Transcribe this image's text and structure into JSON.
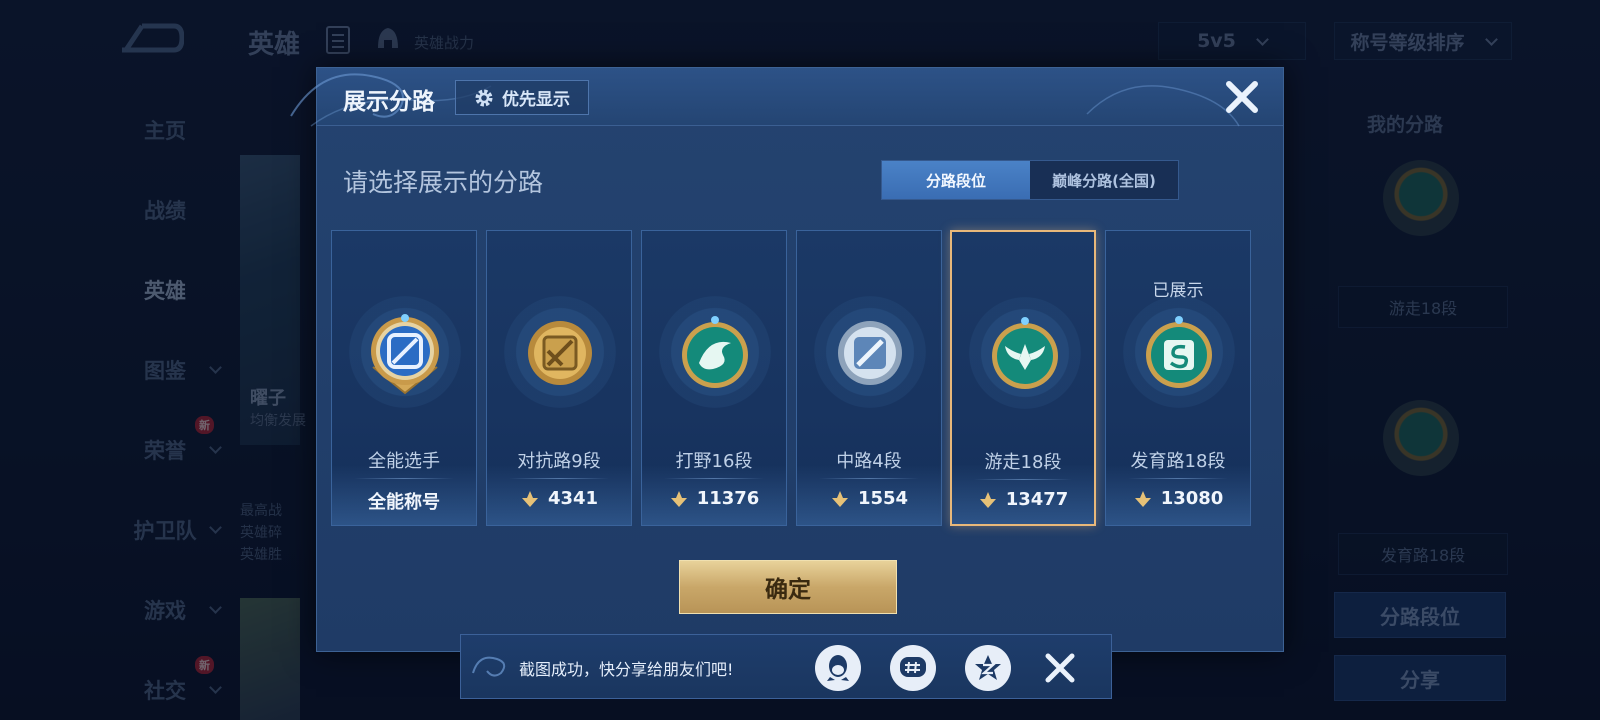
{
  "background": {
    "top_title": "英雄",
    "top_power_label": "英雄战力",
    "mode_select": "5v5",
    "sort_select": "称号等级排序",
    "nav": [
      {
        "label": "主页",
        "active": false,
        "expandable": false,
        "badge": ""
      },
      {
        "label": "战绩",
        "active": false,
        "expandable": false,
        "badge": ""
      },
      {
        "label": "英雄",
        "active": true,
        "expandable": false,
        "badge": ""
      },
      {
        "label": "图鉴",
        "active": false,
        "expandable": true,
        "badge": ""
      },
      {
        "label": "荣誉",
        "active": false,
        "expandable": true,
        "badge": "新"
      },
      {
        "label": "护卫队",
        "active": false,
        "expandable": true,
        "badge": ""
      },
      {
        "label": "游戏",
        "active": false,
        "expandable": true,
        "badge": ""
      },
      {
        "label": "社交",
        "active": false,
        "expandable": true,
        "badge": "新"
      }
    ],
    "hero_name": "曜子",
    "hero_sub": "均衡发展",
    "hero_stats": [
      "最高战",
      "英雄碎",
      "英雄胜"
    ],
    "right_panel": {
      "title": "我的分路",
      "slot1_label": "游走18段",
      "slot2_label": "发育路18段",
      "btn_lane_rank": "分路段位",
      "btn_share": "分享"
    }
  },
  "modal": {
    "title": "展示分路",
    "priority_button": "优先显示",
    "subtitle": "请选择展示的分路",
    "tabs": [
      {
        "label": "分路段位",
        "active": true
      },
      {
        "label": "巅峰分路(全国)",
        "active": false
      }
    ],
    "cards": [
      {
        "rank": "全能选手",
        "score": "全能称号",
        "has_score_icon": false,
        "medal": "all-round-medal",
        "shown_label": "",
        "selected": false
      },
      {
        "rank": "对抗路9段",
        "score": "4341",
        "has_score_icon": true,
        "medal": "clash-lane-medal",
        "shown_label": "",
        "selected": false
      },
      {
        "rank": "打野16段",
        "score": "11376",
        "has_score_icon": true,
        "medal": "jungle-medal",
        "shown_label": "",
        "selected": false
      },
      {
        "rank": "中路4段",
        "score": "1554",
        "has_score_icon": true,
        "medal": "mid-lane-medal",
        "shown_label": "",
        "selected": false
      },
      {
        "rank": "游走18段",
        "score": "13477",
        "has_score_icon": true,
        "medal": "roam-medal",
        "shown_label": "",
        "selected": true
      },
      {
        "rank": "发育路18段",
        "score": "13080",
        "has_score_icon": true,
        "medal": "farm-lane-medal",
        "shown_label": "已展示",
        "selected": false
      }
    ],
    "confirm": "确定"
  },
  "toast": {
    "text": "截图成功，快分享给朋友们吧!",
    "share_targets": [
      "qq-icon",
      "topic-icon",
      "qzone-star-icon"
    ]
  },
  "colors": {
    "accent_gold": "#e8b87a",
    "modal_bg": "#244370",
    "tab_active": "#4a82c7"
  }
}
